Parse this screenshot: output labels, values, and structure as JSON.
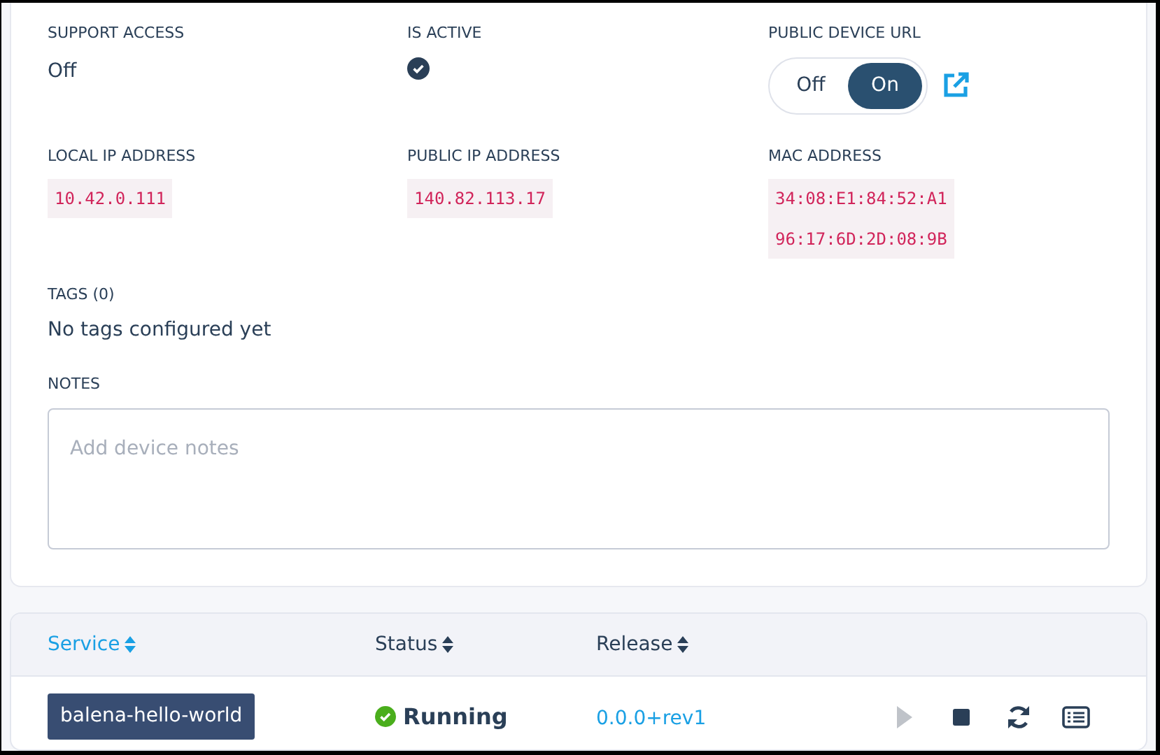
{
  "details": [
    {
      "label": "SUPPORT ACCESS",
      "kind": "text",
      "value": "Off"
    },
    {
      "label": "IS ACTIVE",
      "kind": "check",
      "checked": true
    },
    {
      "label": "PUBLIC DEVICE URL",
      "kind": "toggle",
      "options": [
        {
          "label": "Off",
          "selected": false
        },
        {
          "label": "On",
          "selected": true
        }
      ]
    },
    {
      "label": "LOCAL IP ADDRESS",
      "kind": "code",
      "values": [
        "10.42.0.111"
      ]
    },
    {
      "label": "PUBLIC IP ADDRESS",
      "kind": "code",
      "values": [
        "140.82.113.17"
      ]
    },
    {
      "label": "MAC ADDRESS",
      "kind": "code",
      "values": [
        "34:08:E1:84:52:A1",
        "96:17:6D:2D:08:9B"
      ]
    }
  ],
  "tags": {
    "label": "TAGS (0)",
    "value": "No tags configured yet"
  },
  "notes": {
    "label": "NOTES",
    "placeholder": "Add device notes"
  },
  "services": {
    "columns": [
      {
        "label": "Service",
        "selected": true
      },
      {
        "label": "Status",
        "selected": false
      },
      {
        "label": "Release",
        "selected": false
      }
    ],
    "rows": [
      {
        "service": "balena-hello-world",
        "status": "Running",
        "release": "0.0.0+rev1",
        "actions": [
          {
            "kind": "play",
            "disabled": true
          },
          {
            "kind": "stop",
            "disabled": false
          },
          {
            "kind": "restart",
            "disabled": false
          },
          {
            "kind": "logs",
            "disabled": false
          }
        ]
      }
    ]
  }
}
